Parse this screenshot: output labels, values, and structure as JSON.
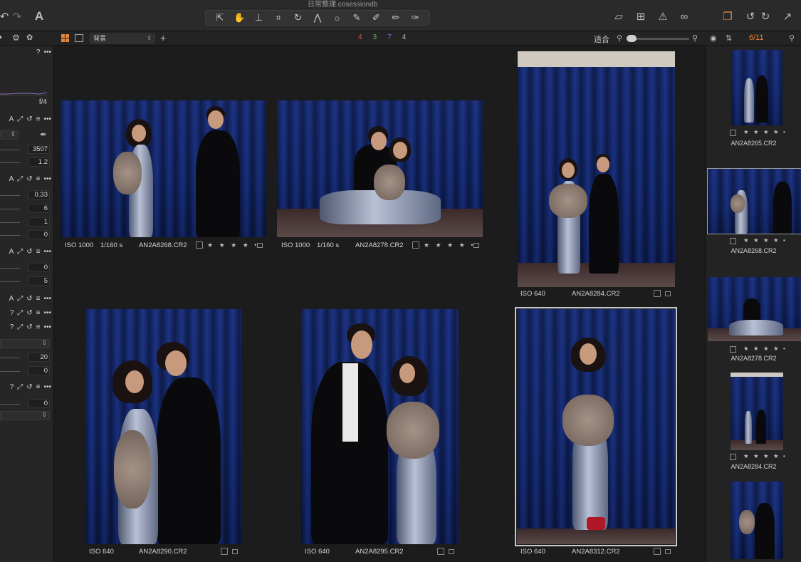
{
  "window": {
    "title": "日常整理.cosessiondb"
  },
  "toolbar": {
    "undo_icon": "undo-icon",
    "redo_icon": "redo-icon",
    "text_tool_label": "A",
    "tools": [
      "select-arrow-icon",
      "pan-hand-icon",
      "stamp-icon",
      "crop-icon",
      "rotate-icon",
      "keystone-icon",
      "circle-mask-icon",
      "brush-icon",
      "pen-icon",
      "eraser-icon",
      "gradient-pen-icon"
    ],
    "right_tools": [
      "compare-icon",
      "grid-overlay-icon",
      "warning-icon",
      "glasses-icon",
      "stack-icon",
      "rotate-left-icon",
      "rotate-right-icon",
      "export-arrow-icon"
    ]
  },
  "subbar": {
    "album_select": "背景",
    "counts": [
      {
        "value": "4",
        "color": "#d9534f"
      },
      {
        "value": "3",
        "color": "#5cb85c"
      },
      {
        "value": "7",
        "color": "#6f6fd9"
      },
      {
        "value": "4",
        "color": "#bdbdbd"
      }
    ],
    "fit_label": "适合",
    "browser_count": "6/11",
    "zoom_level": 0.05
  },
  "left_panel": {
    "histogram_label": "f/4",
    "sections": [
      {
        "values": [
          "3507",
          "1.2"
        ]
      },
      {
        "values": [
          "0.33",
          "6",
          "1",
          "0"
        ]
      },
      {
        "values": [
          "0",
          "5"
        ]
      },
      {
        "values": [
          "20",
          "0"
        ]
      },
      {
        "values": [
          "0"
        ]
      }
    ],
    "question": "?",
    "more": "•••",
    "head_a": "A"
  },
  "grid": {
    "photos": [
      {
        "iso": "ISO 1000",
        "shutter": "1/160 s",
        "name": "AN2A8268.CR2",
        "stars": "★ ★ ★ ★ •"
      },
      {
        "iso": "ISO 1000",
        "shutter": "1/160 s",
        "name": "AN2A8278.CR2",
        "stars": "★ ★ ★ ★ •"
      },
      {
        "iso": "ISO 640",
        "shutter": "",
        "name": "AN2A8284.CR2",
        "stars": ""
      },
      {
        "iso": "ISO 640",
        "shutter": "",
        "name": "AN2A8290.CR2",
        "stars": ""
      },
      {
        "iso": "ISO 640",
        "shutter": "",
        "name": "AN2A8295.CR2",
        "stars": ""
      },
      {
        "iso": "ISO 640",
        "shutter": "",
        "name": "AN2A8312.CR2",
        "stars": ""
      }
    ]
  },
  "filmstrip": {
    "items": [
      {
        "name": "AN2A8265.CR2",
        "stars": "★ ★ ★ ★ •"
      },
      {
        "name": "AN2A8268.CR2",
        "stars": "★ ★ ★ ★ •"
      },
      {
        "name": "AN2A8278.CR2",
        "stars": "★ ★ ★ ★ •"
      },
      {
        "name": "AN2A8284.CR2",
        "stars": "★ ★ ★ ★ •"
      },
      {
        "name": "",
        "stars": ""
      }
    ]
  }
}
